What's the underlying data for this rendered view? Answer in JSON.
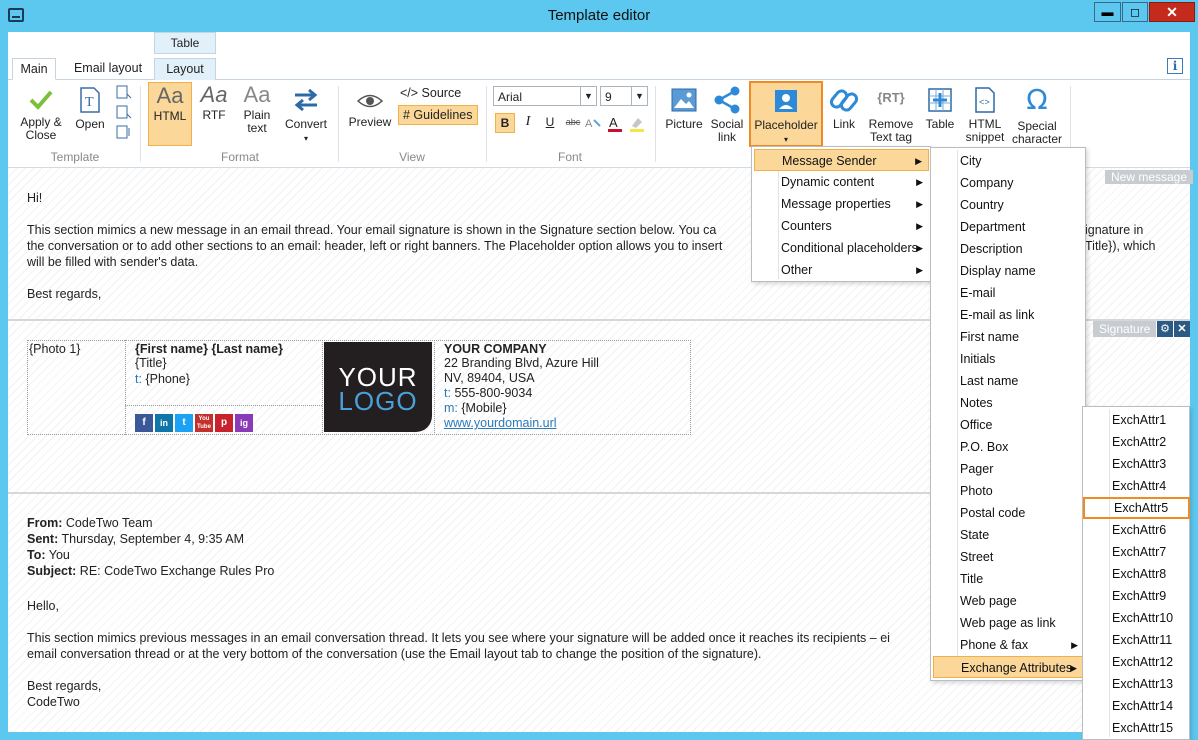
{
  "window": {
    "title": "Template editor",
    "min": "▬",
    "max": "◻",
    "close": "✕"
  },
  "ribbon_tabs": {
    "context_header": "Table",
    "main": "Main",
    "email_layout": "Email layout",
    "layout": "Layout",
    "info": "i"
  },
  "template_group": {
    "label": "Template",
    "apply": "Apply &",
    "apply2": "Close",
    "open": "Open"
  },
  "format_group": {
    "label": "Format",
    "html": "HTML",
    "rtf": "RTF",
    "plain": "Plain",
    "plain2": "text",
    "convert": "Convert",
    "html_icon": "Aa",
    "rtf_icon": "Aa",
    "plain_icon": "Aa"
  },
  "view_group": {
    "label": "View",
    "preview": "Preview",
    "source": "</> Source",
    "guidelines": "# Guidelines"
  },
  "font_group": {
    "label": "Font",
    "font_name": "Arial",
    "font_size": "9",
    "bold": "B",
    "italic": "I",
    "underline": "U",
    "strike": "abc"
  },
  "insert_group": {
    "picture": "Picture",
    "social": "Social",
    "social2": "link",
    "placeholder": "Placeholder",
    "link": "Link",
    "remove": "Remove",
    "remove2": "Text tag",
    "table": "Table",
    "html_snippet": "HTML",
    "html_snippet2": "snippet",
    "special": "Special",
    "special2": "character",
    "rt_icon": "{RT}",
    "omega_icon": "Ω"
  },
  "sections": {
    "new_message": "New message",
    "signature": "Signature"
  },
  "new_message": {
    "greeting": "Hi!",
    "line1": "This section mimics a new message in an email thread. Your email signature is shown in the Signature section below. You ca",
    "line1_end": "ignature in",
    "line2": "the conversation or to add other sections to an email: header, left or right banners. The Placeholder option allows you to insert",
    "line2_end": "Title}), which",
    "line3": "will be filled with sender's data.",
    "closing": "Best regards,"
  },
  "signature": {
    "photo": "{Photo 1}",
    "name": "{First name} {Last name}",
    "title": "{Title}",
    "phone_prefix": "t:",
    "phone": "{Phone}",
    "logo1": "YOUR",
    "logo2": "LOGO",
    "company": "YOUR COMPANY",
    "address1": "22 Branding Blvd, Azure Hill",
    "address2": "NV, 89404, USA",
    "tel_prefix": "t:",
    "tel": "555-800-9034",
    "mobile_prefix": "m:",
    "mobile": "{Mobile}",
    "url": "www.yourdomain.url",
    "social_icons": [
      "f",
      "in",
      "t",
      "You Tube",
      "p",
      "ig"
    ]
  },
  "previous_message": {
    "from_label": "From:",
    "from": "CodeTwo Team",
    "sent_label": "Sent:",
    "sent": "Thursday, September 4, 9:35 AM",
    "to_label": "To:",
    "to": "You",
    "subject_label": "Subject:",
    "subject": "RE: CodeTwo Exchange Rules Pro",
    "hello": "Hello,",
    "line1": "This section mimics previous messages in an email conversation thread. It lets you see where your signature will be added once it reaches its recipients – ei",
    "line2": "email conversation thread or at the very bottom of the conversation (use the Email layout tab to change the position of the signature).",
    "closing": "Best regards,",
    "sender": "CodeTwo"
  },
  "placeholder_menu": [
    "Message Sender",
    "Dynamic content",
    "Message properties",
    "Counters",
    "Conditional placeholders",
    "Other"
  ],
  "sender_menu": [
    "City",
    "Company",
    "Country",
    "Department",
    "Description",
    "Display name",
    "E-mail",
    "E-mail as link",
    "First name",
    "Initials",
    "Last name",
    "Notes",
    "Office",
    "P.O. Box",
    "Pager",
    "Photo",
    "Postal code",
    "State",
    "Street",
    "Title",
    "Web page",
    "Web page as link",
    "Phone & fax",
    "Exchange Attributes"
  ],
  "exchange_menu": [
    "ExchAttr1",
    "ExchAttr2",
    "ExchAttr3",
    "ExchAttr4",
    "ExchAttr5",
    "ExchAttr6",
    "ExchAttr7",
    "ExchAttr8",
    "ExchAttr9",
    "ExchAttr10",
    "ExchAttr11",
    "ExchAttr12",
    "ExchAttr13",
    "ExchAttr14",
    "ExchAttr15"
  ],
  "colors": {
    "titlebar": "#5cc8f0",
    "highlight": "#fbd89a",
    "highlight_border": "#f0b14a",
    "selected_border": "#f08a24",
    "link": "#2a7ab8"
  }
}
